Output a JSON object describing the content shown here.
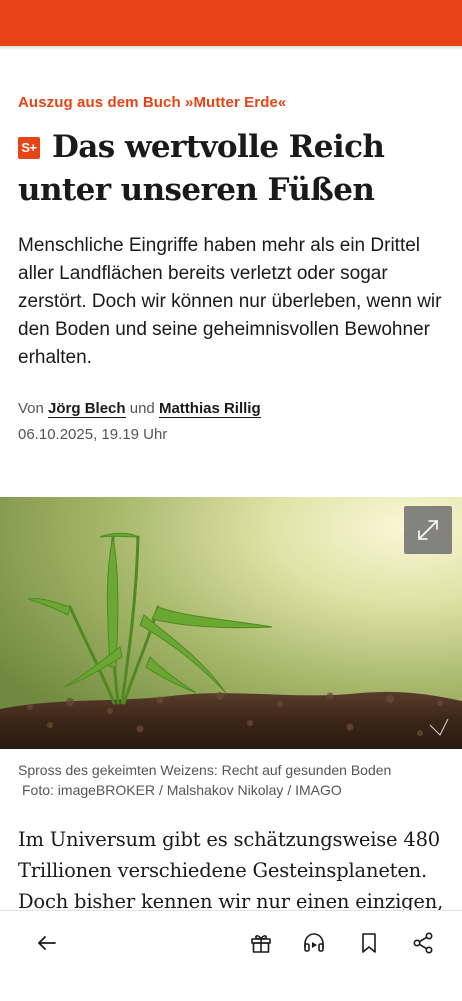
{
  "colors": {
    "accent": "#e64415",
    "text": "#1a1a1a",
    "muted": "#555555"
  },
  "article": {
    "kicker": "Auszug aus dem Buch »Mutter Erde«",
    "badge": "S+",
    "headline": "Das wertvolle Reich unter unseren Füßen",
    "intro": "Menschliche Eingriffe haben mehr als ein Drittel aller Landflächen bereits verletzt oder sogar zerstört. Doch wir können nur überleben, wenn wir den Boden und seine geheimnisvollen Bewohner erhalten.",
    "byline": {
      "prefix": "Von",
      "author1": "Jörg Blech",
      "conjunction": "und",
      "author2": "Matthias Rillig"
    },
    "date": "06.10.2025, 19.19 Uhr",
    "image": {
      "caption": "Spross des gekeimten Weizens: Recht auf gesunden Boden",
      "credit": "Foto: imageBROKER / Malshakov Nikolay / IMAGO",
      "expand_icon": "expand-icon"
    },
    "body_start": "Im Universum gibt es schätzungsweise 480 Trillionen verschiedene Gesteinsplaneten. Doch bisher kennen wir nur einen einzigen, dessen"
  },
  "bottom_nav": {
    "icons": [
      "back-arrow-icon",
      "gift-icon",
      "headphones-icon",
      "bookmark-icon",
      "share-icon"
    ]
  }
}
